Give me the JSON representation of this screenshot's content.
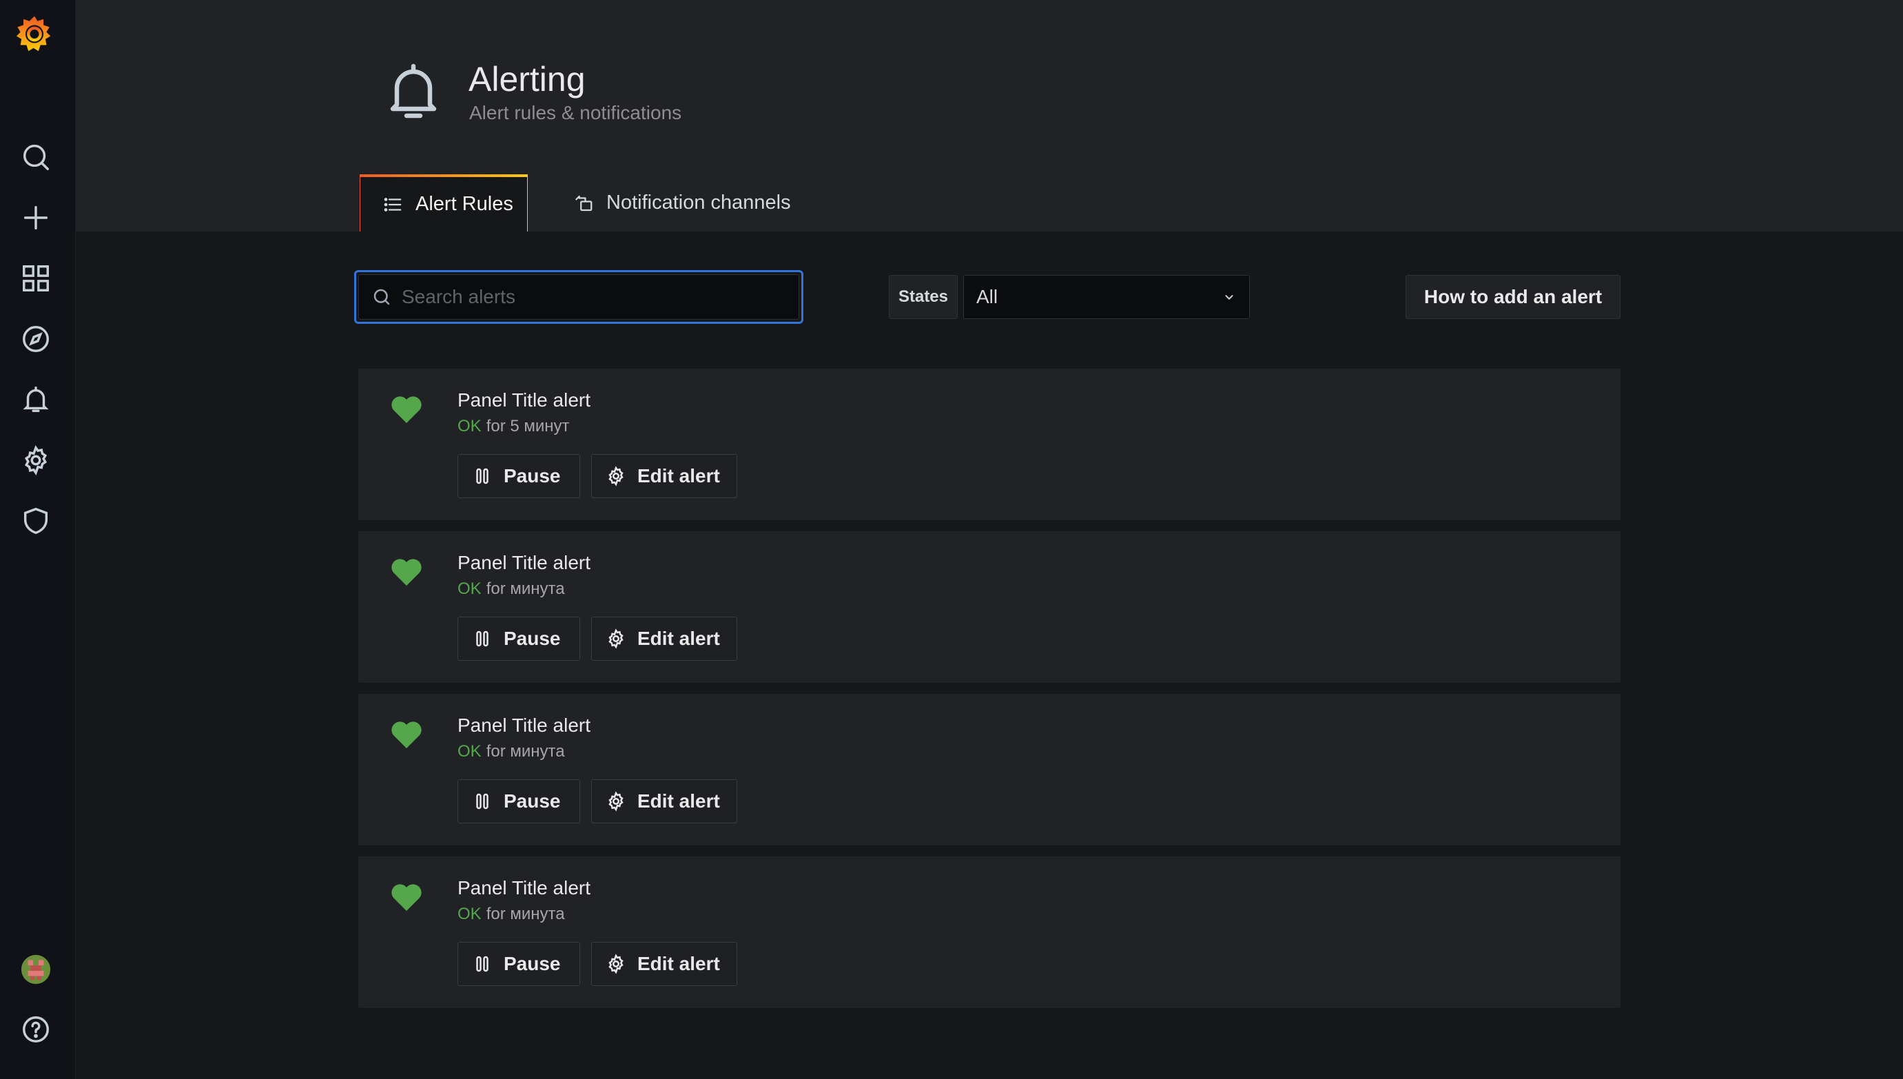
{
  "sidebar": {
    "logo": "grafana-logo-icon",
    "items": [
      {
        "icon": "search-icon"
      },
      {
        "icon": "plus-icon"
      },
      {
        "icon": "dashboards-grid-icon"
      },
      {
        "icon": "compass-explore-icon"
      },
      {
        "icon": "bell-alerting-icon"
      },
      {
        "icon": "gear-config-icon"
      },
      {
        "icon": "shield-icon"
      }
    ],
    "bottom": [
      {
        "icon": "avatar"
      },
      {
        "icon": "help-icon"
      }
    ]
  },
  "header": {
    "title": "Alerting",
    "subtitle": "Alert rules & notifications",
    "tabs": [
      {
        "label": "Alert Rules",
        "icon": "list-icon",
        "active": true
      },
      {
        "label": "Notification channels",
        "icon": "channel-icon",
        "active": false
      }
    ]
  },
  "toolbar": {
    "search_placeholder": "Search alerts",
    "search_value": "",
    "states_label": "States",
    "states_value": "All",
    "how_to_label": "How to add an alert"
  },
  "alerts": [
    {
      "title": "Panel Title alert",
      "state": "OK",
      "duration": "for 5 минут",
      "pause_label": "Pause",
      "edit_label": "Edit alert"
    },
    {
      "title": "Panel Title alert",
      "state": "OK",
      "duration": "for минута",
      "pause_label": "Pause",
      "edit_label": "Edit alert"
    },
    {
      "title": "Panel Title alert",
      "state": "OK",
      "duration": "for минута",
      "pause_label": "Pause",
      "edit_label": "Edit alert"
    },
    {
      "title": "Panel Title alert",
      "state": "OK",
      "duration": "for минута",
      "pause_label": "Pause",
      "edit_label": "Edit alert"
    }
  ],
  "colors": {
    "accent": "#3274d9",
    "ok": "#56a64b",
    "tab_gradient_start": "#f05a28",
    "tab_gradient_end": "#fbca0a"
  }
}
